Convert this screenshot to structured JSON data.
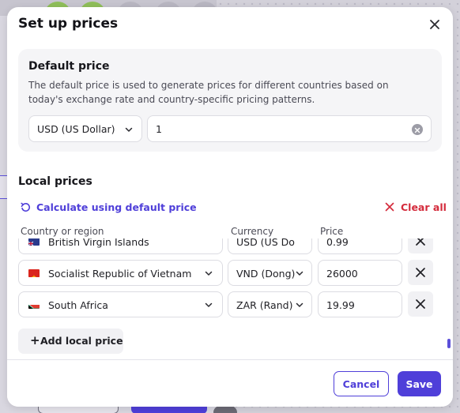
{
  "modal": {
    "title": "Set up prices"
  },
  "default_price": {
    "title": "Default price",
    "description": "The default price is used to generate prices for different countries based on today's exchange rate and country-specific pricing patterns.",
    "currency": "USD (US Dollar)",
    "amount": "1"
  },
  "local_prices": {
    "title": "Local prices",
    "calculate_label": "Calculate using default price",
    "clear_all_label": "Clear all",
    "columns": {
      "country": "Country or region",
      "currency": "Currency",
      "price": "Price"
    },
    "rows": [
      {
        "country": "British Virgin Islands",
        "flag": "vg",
        "currency": "USD (US Do",
        "price": "0.99"
      },
      {
        "country": "Socialist Republic of Vietnam",
        "flag": "vn",
        "currency": "VND (Dong)",
        "price": "26000"
      },
      {
        "country": "South Africa",
        "flag": "za",
        "currency": "ZAR (Rand)",
        "price": "19.99"
      }
    ],
    "add_label": "Add local price"
  },
  "footer": {
    "cancel_label": "Cancel",
    "save_label": "Save"
  },
  "colors": {
    "accent": "#4f3fd9",
    "danger": "#d42b3c"
  }
}
